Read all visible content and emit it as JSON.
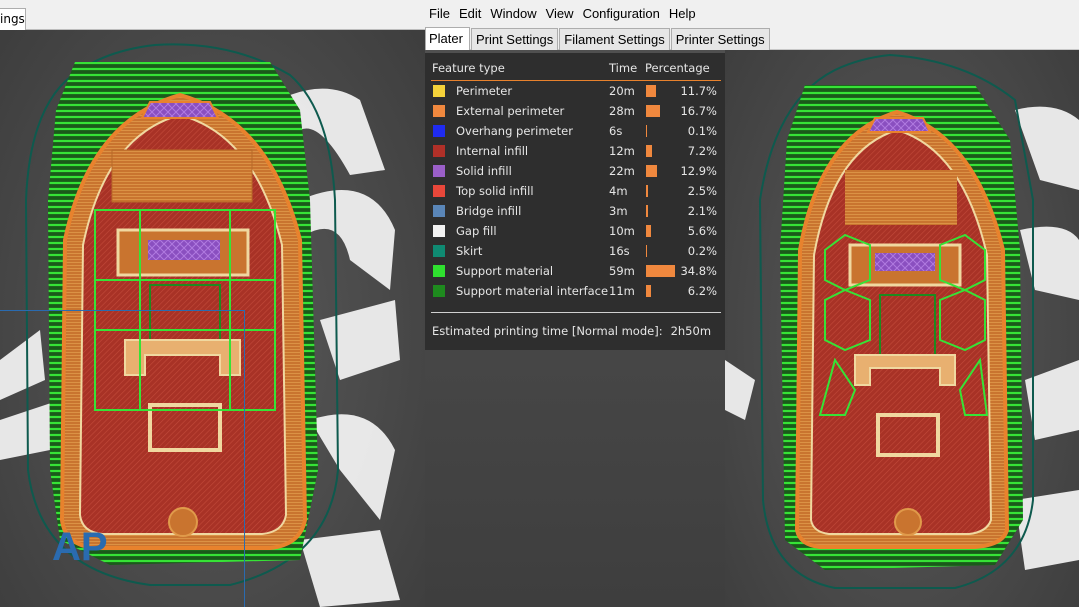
{
  "left_window": {
    "tab_label": "ings"
  },
  "menu": [
    "File",
    "Edit",
    "Window",
    "View",
    "Configuration",
    "Help"
  ],
  "tabs": [
    {
      "label": "Plater",
      "active": true
    },
    {
      "label": "Print Settings",
      "active": false
    },
    {
      "label": "Filament Settings",
      "active": false
    },
    {
      "label": "Printer Settings",
      "active": false
    }
  ],
  "legend": {
    "header": {
      "feature": "Feature type",
      "time": "Time",
      "percentage": "Percentage"
    },
    "rows": [
      {
        "color": "#f5d23a",
        "label": "Perimeter",
        "time": "20m",
        "pct": "11.7%",
        "fraction": 0.117
      },
      {
        "color": "#f0883e",
        "label": "External perimeter",
        "time": "28m",
        "pct": "16.7%",
        "fraction": 0.167
      },
      {
        "color": "#1f2bf0",
        "label": "Overhang perimeter",
        "time": "6s",
        "pct": "0.1%",
        "fraction": 0.001
      },
      {
        "color": "#b03028",
        "label": "Internal infill",
        "time": "12m",
        "pct": "7.2%",
        "fraction": 0.072
      },
      {
        "color": "#9a5fc8",
        "label": "Solid infill",
        "time": "22m",
        "pct": "12.9%",
        "fraction": 0.129
      },
      {
        "color": "#e8473a",
        "label": "Top solid infill",
        "time": "4m",
        "pct": "2.5%",
        "fraction": 0.025
      },
      {
        "color": "#5a86b8",
        "label": "Bridge infill",
        "time": "3m",
        "pct": "2.1%",
        "fraction": 0.021
      },
      {
        "color": "#f2f2f2",
        "label": "Gap fill",
        "time": "10m",
        "pct": "5.6%",
        "fraction": 0.056
      },
      {
        "color": "#0f8a72",
        "label": "Skirt",
        "time": "16s",
        "pct": "0.2%",
        "fraction": 0.002
      },
      {
        "color": "#2fe02f",
        "label": "Support material",
        "time": "59m",
        "pct": "34.8%",
        "fraction": 0.348
      },
      {
        "color": "#1e8a1e",
        "label": "Support material interface",
        "time": "11m",
        "pct": "6.2%",
        "fraction": 0.062
      }
    ],
    "estimate_label": "Estimated printing time [Normal mode]:",
    "estimate_value": "2h50m"
  },
  "watermark": {
    "text": "AP"
  }
}
